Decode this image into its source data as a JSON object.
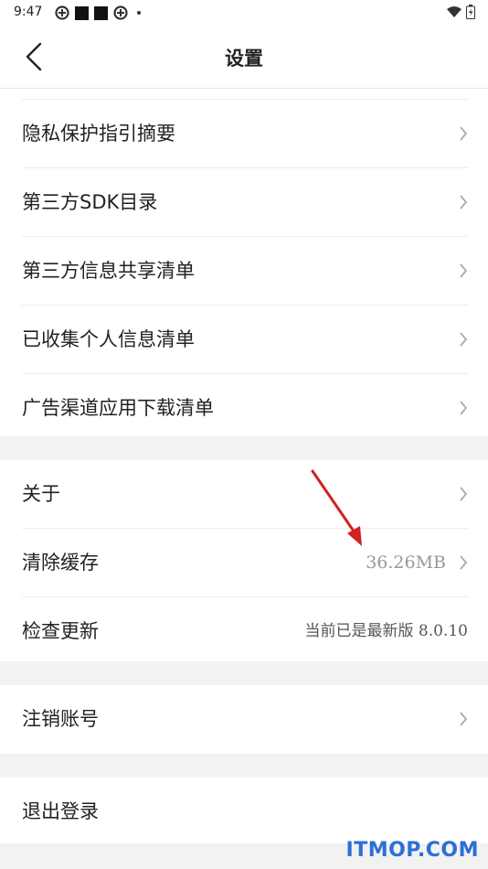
{
  "status_bar": {
    "time": "9:47"
  },
  "header": {
    "title": "设置"
  },
  "section1": [
    {
      "label": "隐私保护指引摘要"
    },
    {
      "label": "第三方SDK目录"
    },
    {
      "label": "第三方信息共享清单"
    },
    {
      "label": "已收集个人信息清单"
    },
    {
      "label": "广告渠道应用下载清单"
    }
  ],
  "section2": {
    "about": {
      "label": "关于"
    },
    "clear_cache": {
      "label": "清除缓存",
      "value": "36.26MB"
    },
    "check_update": {
      "label": "检查更新",
      "value": "当前已是最新版 8.0.10"
    }
  },
  "section3": {
    "cancel_account": {
      "label": "注销账号"
    }
  },
  "section4": {
    "logout": {
      "label": "退出登录"
    }
  },
  "watermark": "ITMOP.COM",
  "colors": {
    "annotation_arrow": "#d42020",
    "watermark": "#2c6fd6"
  }
}
